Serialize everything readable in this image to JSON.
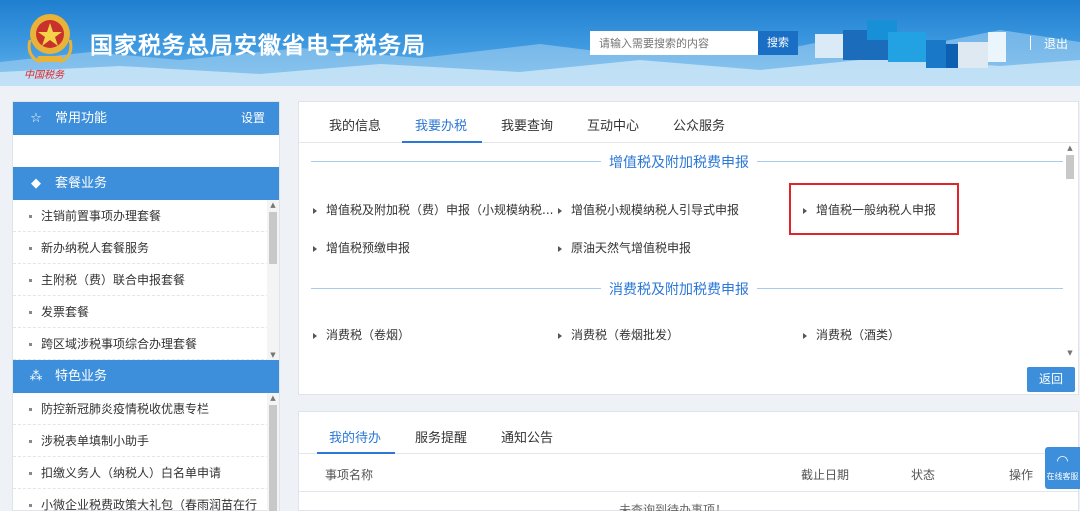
{
  "header": {
    "site_title": "国家税务总局安徽省电子税务局",
    "logo_text": "中国税务",
    "search_placeholder": "请输入需要搜索的内容",
    "search_button": "搜索",
    "logout": "退出"
  },
  "sidebar": {
    "common": {
      "title": "常用功能",
      "settings": "设置"
    },
    "package": {
      "title": "套餐业务",
      "items": [
        "注销前置事项办理套餐",
        "新办纳税人套餐服务",
        "主附税（费）联合申报套餐",
        "发票套餐",
        "跨区域涉税事项综合办理套餐"
      ]
    },
    "special": {
      "title": "特色业务",
      "items": [
        "防控新冠肺炎疫情税收优惠专栏",
        "涉税表单填制小助手",
        "扣缴义务人（纳税人）白名单申请",
        "小微企业税费政策大礼包（春雨润苗在行"
      ]
    }
  },
  "main": {
    "tabs": [
      "我的信息",
      "我要办税",
      "我要查询",
      "互动中心",
      "公众服务"
    ],
    "active_tab": "我要办税",
    "vat_section": {
      "title": "增值税及附加税费申报",
      "links": [
        "增值税及附加税（费）申报（小规模纳税...",
        "增值税小规模纳税人引导式申报",
        "增值税一般纳税人申报",
        "增值税预缴申报",
        "原油天然气增值税申报"
      ]
    },
    "consumption_section": {
      "title": "消费税及附加税费申报",
      "links": [
        "消费税（卷烟）",
        "消费税（卷烟批发）",
        "消费税（酒类）"
      ]
    },
    "back_button": "返回"
  },
  "todo": {
    "tabs": [
      "我的待办",
      "服务提醒",
      "通知公告"
    ],
    "active_tab": "我的待办",
    "columns": [
      "事项名称",
      "截止日期",
      "状态",
      "操作"
    ],
    "empty_text": "未查询到待办事项！"
  },
  "online_service": {
    "label": "在线客服"
  },
  "colors": {
    "accent": "#2b78d6",
    "sidebar_head": "#3d8fdb",
    "highlight": "#e0242a"
  }
}
